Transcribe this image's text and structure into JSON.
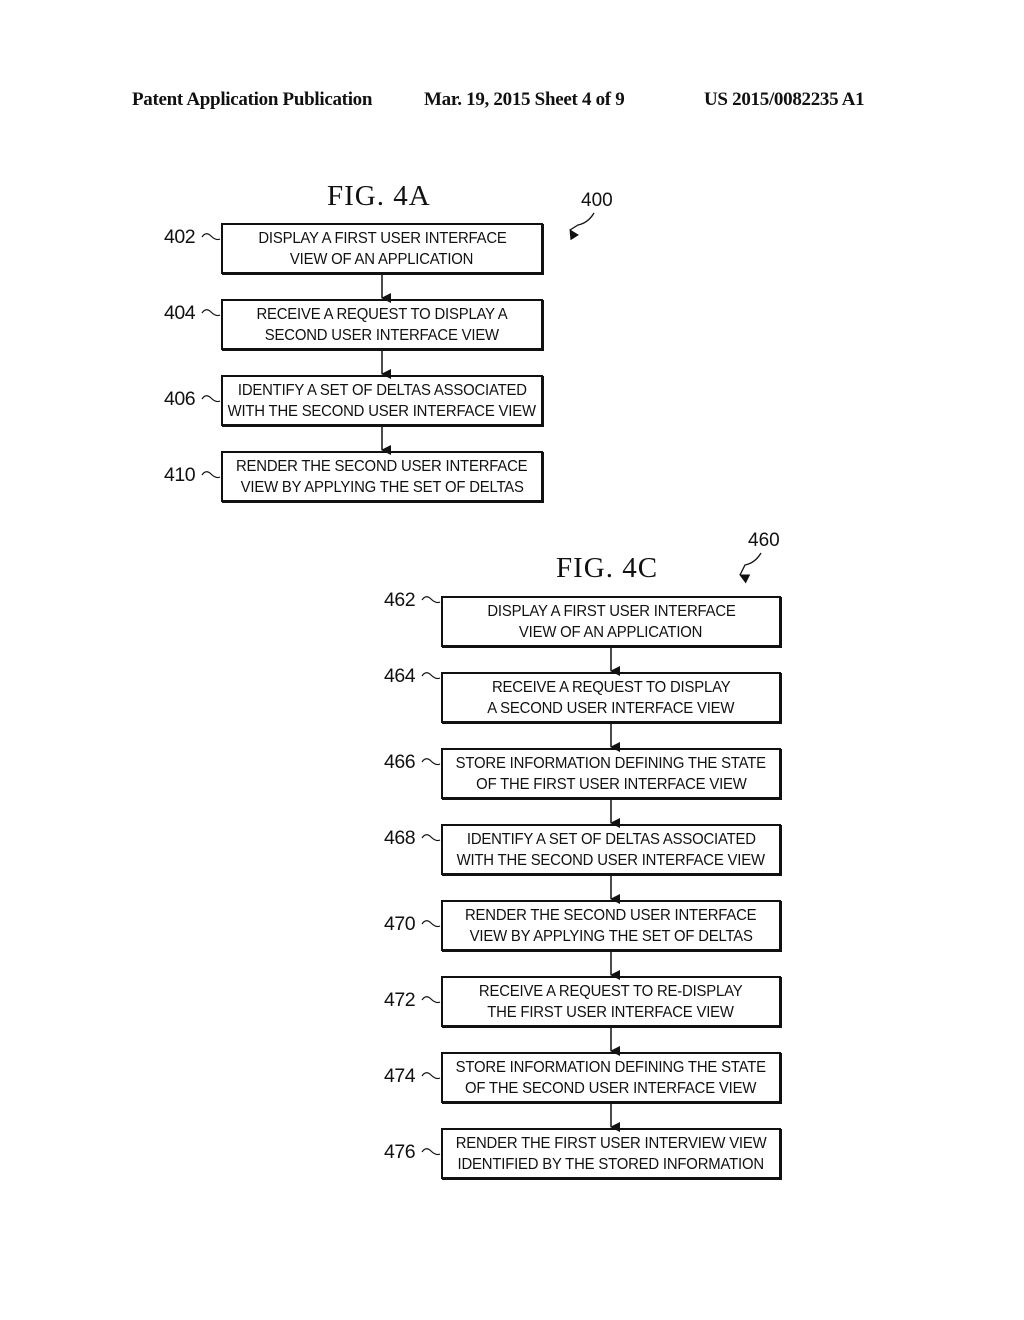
{
  "header": {
    "publication": "Patent Application Publication",
    "date_sheet": "Mar. 19, 2015  Sheet 4 of 9",
    "number": "US 2015/0082235 A1"
  },
  "figures": [
    {
      "title": "FIG. 4A",
      "ref": "400",
      "steps": [
        {
          "label": "402",
          "lines": [
            "DISPLAY A FIRST USER INTERFACE",
            "VIEW OF AN APPLICATION"
          ]
        },
        {
          "label": "404",
          "lines": [
            "RECEIVE A REQUEST TO DISPLAY A",
            "SECOND USER INTERFACE VIEW"
          ]
        },
        {
          "label": "406",
          "lines": [
            "IDENTIFY A SET OF DELTAS ASSOCIATED",
            "WITH THE SECOND USER INTERFACE VIEW"
          ]
        },
        {
          "label": "410",
          "lines": [
            "RENDER THE SECOND USER INTERFACE",
            "VIEW BY APPLYING THE SET OF DELTAS"
          ]
        }
      ]
    },
    {
      "title": "FIG. 4C",
      "ref": "460",
      "steps": [
        {
          "label": "462",
          "lines": [
            "DISPLAY A FIRST USER INTERFACE",
            "VIEW OF AN APPLICATION"
          ]
        },
        {
          "label": "464",
          "lines": [
            "RECEIVE A REQUEST TO DISPLAY",
            "A SECOND USER INTERFACE VIEW"
          ]
        },
        {
          "label": "466",
          "lines": [
            "STORE INFORMATION DEFINING THE STATE",
            "OF THE FIRST USER INTERFACE VIEW"
          ]
        },
        {
          "label": "468",
          "lines": [
            "IDENTIFY A SET OF DELTAS ASSOCIATED",
            "WITH THE SECOND USER INTERFACE VIEW"
          ]
        },
        {
          "label": "470",
          "lines": [
            "RENDER THE SECOND USER INTERFACE",
            "VIEW BY APPLYING THE SET OF DELTAS"
          ]
        },
        {
          "label": "472",
          "lines": [
            "RECEIVE A REQUEST TO RE-DISPLAY",
            "THE FIRST USER INTERFACE VIEW"
          ]
        },
        {
          "label": "474",
          "lines": [
            "STORE INFORMATION DEFINING THE STATE",
            "OF THE SECOND USER INTERFACE VIEW"
          ]
        },
        {
          "label": "476",
          "lines": [
            "RENDER THE FIRST USER INTERVIEW VIEW",
            "IDENTIFIED BY THE STORED INFORMATION"
          ]
        }
      ]
    }
  ]
}
